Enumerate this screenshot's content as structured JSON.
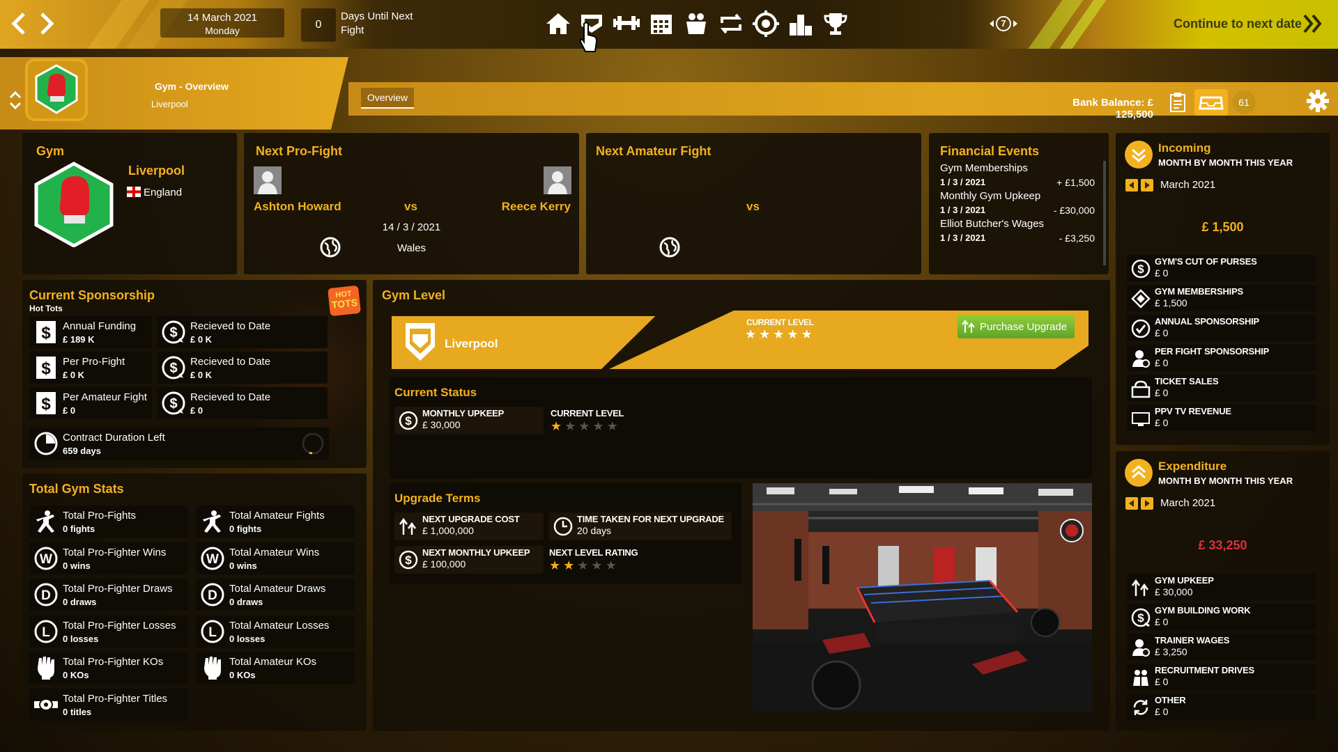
{
  "topbar": {
    "date": "14 March 2021",
    "weekday": "Monday",
    "days_until_count": "0",
    "days_until_label_1": "Days Until Next",
    "days_until_label_2": "Fight",
    "nav_icons": [
      "home-icon",
      "gym-icon",
      "training-icon",
      "calendar-icon",
      "fighters-icon",
      "transfer-icon",
      "scouting-icon",
      "rankings-icon",
      "trophy-icon"
    ],
    "badge_count": "7",
    "continue_label": "Continue to next date"
  },
  "header": {
    "section": "Gym - Overview",
    "location": "Liverpool",
    "tab": "Overview",
    "bank_balance": "Bank Balance: £ 125,500",
    "inbox_count": "61"
  },
  "gym": {
    "title": "Gym",
    "city": "Liverpool",
    "country": "England"
  },
  "pro_fight": {
    "title": "Next Pro-Fight",
    "fighter_a": "Ashton Howard",
    "vs": "vs",
    "fighter_b": "Reece Kerry",
    "date": "14 / 3 / 2021",
    "venue": "Wales"
  },
  "amateur_fight": {
    "title": "Next Amateur Fight",
    "vs": "vs"
  },
  "financial_events": {
    "title": "Financial Events",
    "items": [
      {
        "name": "Gym Memberships",
        "date": "1 / 3 / 2021",
        "amount": "+ £1,500"
      },
      {
        "name": "Monthly Gym Upkeep",
        "date": "1 / 3 / 2021",
        "amount": "- £30,000"
      },
      {
        "name": "Elliot Butcher's Wages",
        "date": "1 / 3 / 2021",
        "amount": "- £3,250"
      }
    ]
  },
  "incoming": {
    "title": "Incoming",
    "subtitle": "MONTH BY MONTH THIS YEAR",
    "month": "March 2021",
    "total": "£ 1,500",
    "items": [
      {
        "label": "GYM'S CUt OF PURSES",
        "value": "£ 0"
      },
      {
        "label": "GYM MEMBERSHIPS",
        "value": "£ 1,500"
      },
      {
        "label": "ANNUAL SPONSORSHIP",
        "value": "£ 0"
      },
      {
        "label": "PER FIGHT SPONSORSHIP",
        "value": "£ 0"
      },
      {
        "label": "TICKET SALES",
        "value": "£ 0"
      },
      {
        "label": "PPV TV REVENUE",
        "value": "£ 0"
      }
    ]
  },
  "expenditure": {
    "title": "Expenditure",
    "subtitle": "MONTH BY MONTH THIS YEAR",
    "month": "March 2021",
    "total": "£ 33,250",
    "items": [
      {
        "label": "GYM UPKEEP",
        "value": "£ 30,000"
      },
      {
        "label": "GYM BUILDING WORK",
        "value": "£ 0"
      },
      {
        "label": "TRAINER WAGES",
        "value": "£ 3,250"
      },
      {
        "label": "RECRUITMENT DRIVES",
        "value": "£ 0"
      },
      {
        "label": "OTHER",
        "value": "£ 0"
      }
    ]
  },
  "sponsorship": {
    "title": "Current Sponsorship",
    "sponsor": "Hot Tots",
    "logo_top": "HOT",
    "logo_bottom": "TOTS",
    "items": [
      {
        "label": "Annual Funding",
        "value": "£ 189 K"
      },
      {
        "label": "Recieved to Date",
        "value": "£ 0 K"
      },
      {
        "label": "Per Pro-Fight",
        "value": "£ 0 K"
      },
      {
        "label": "Recieved to Date",
        "value": "£ 0 K"
      },
      {
        "label": "Per Amateur Fight",
        "value": "£ 0"
      },
      {
        "label": "Recieved to Date",
        "value": "£ 0"
      }
    ],
    "duration_label": "Contract Duration Left",
    "duration_value": "659 days"
  },
  "gym_level": {
    "title": "Gym Level",
    "name": "Liverpool",
    "current_level_label": "CURRENT LEVEL",
    "current_level_stars": 5,
    "purchase_label": "Purchase Upgrade"
  },
  "current_status": {
    "title": "Current Status",
    "upkeep_label": "MONTHLY UPKEEP",
    "upkeep_value": "£ 30,000",
    "level_label": "CURRENT LEVEL",
    "level_stars": 1
  },
  "upgrade_terms": {
    "title": "Upgrade Terms",
    "cost_label": "NEXT UPGRADE COST",
    "cost_value": "£ 1,000,000",
    "time_label": "TIME TAKEN FOR NEXT UPGRADE",
    "time_value": "20 days",
    "upkeep_label": "NEXT MONTHLY UPKEEP",
    "upkeep_value": "£ 100,000",
    "rating_label": "NEXT LEVEL RATING",
    "rating_stars": 2
  },
  "stats": {
    "title": "Total Gym Stats",
    "pro": [
      {
        "label": "Total Pro-Fights",
        "value": "0 fights"
      },
      {
        "label": "Total Pro-Fighter Wins",
        "value": "0 wins"
      },
      {
        "label": "Total Pro-Fighter Draws",
        "value": "0 draws"
      },
      {
        "label": "Total Pro-Fighter Losses",
        "value": "0 losses"
      },
      {
        "label": "Total Pro-Fighter KOs",
        "value": "0 KOs"
      },
      {
        "label": "Total Pro-Fighter Titles",
        "value": "0 titles"
      }
    ],
    "amateur": [
      {
        "label": "Total Amateur Fights",
        "value": "0 fights"
      },
      {
        "label": "Total Amateur Wins",
        "value": "0 wins"
      },
      {
        "label": "Total Amateur Draws",
        "value": "0 draws"
      },
      {
        "label": "Total Amateur Losses",
        "value": "0 losses"
      },
      {
        "label": "Total Amateur KOs",
        "value": "0 KOs"
      }
    ]
  },
  "colors": {
    "accent": "#f2b21f",
    "gym_badge": "#22b24c",
    "negative": "#d93240",
    "positive": "#f2b21f"
  }
}
